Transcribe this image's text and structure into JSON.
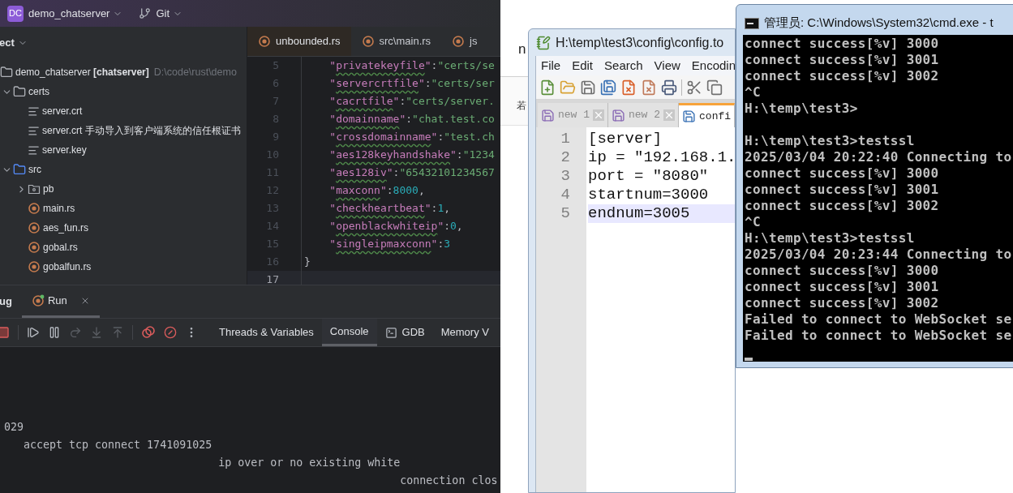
{
  "ide": {
    "project_badge": "DC",
    "project_name": "demo_chatserver",
    "vcs": "Git",
    "project_panel": {
      "title": "ect",
      "tree": [
        {
          "label": "demo_chatserver **[chatserver]**",
          "path": "D:\\code\\rust\\demo",
          "kind": "folder",
          "children": [
            {
              "label": "certs",
              "kind": "folder",
              "expanded": true,
              "children": [
                {
                  "label": "server.crt",
                  "kind": "text"
                },
                {
                  "label": "server.crt 手动导入到客户端系统的信任根证书",
                  "kind": "text"
                },
                {
                  "label": "server.key",
                  "kind": "text"
                }
              ]
            },
            {
              "label": "src",
              "kind": "source-folder",
              "expanded": true,
              "children": [
                {
                  "label": "pb",
                  "kind": "package",
                  "expanded": false
                },
                {
                  "label": "main.rs",
                  "kind": "rust"
                },
                {
                  "label": "aes_fun.rs",
                  "kind": "rust"
                },
                {
                  "label": "gobal.rs",
                  "kind": "rust"
                },
                {
                  "label": "gobalfun.rs",
                  "kind": "rust"
                }
              ]
            }
          ]
        }
      ]
    },
    "editor_tabs": [
      {
        "label": "unbounded.rs",
        "selected": true
      },
      {
        "label": "src\\main.rs",
        "selected": false
      },
      {
        "label": "js",
        "selected": false
      }
    ],
    "code_lines": [
      {
        "number": "5",
        "current": false,
        "tokens": [
          {
            "kind": "quote",
            "text": "    \""
          },
          {
            "kind": "key",
            "text": "privatekeyfile"
          },
          {
            "kind": "quote",
            "text": "\""
          },
          {
            "kind": "punct",
            "text": ":"
          },
          {
            "kind": "string",
            "text": "\"certs/se"
          }
        ]
      },
      {
        "number": "6",
        "current": false,
        "tokens": [
          {
            "kind": "quote",
            "text": "    \""
          },
          {
            "kind": "key",
            "text": "servercrtfile"
          },
          {
            "kind": "quote",
            "text": "\""
          },
          {
            "kind": "punct",
            "text": ":"
          },
          {
            "kind": "string",
            "text": "\"certs/ser"
          }
        ]
      },
      {
        "number": "7",
        "current": false,
        "tokens": [
          {
            "kind": "quote",
            "text": "    \""
          },
          {
            "kind": "key",
            "text": "cacrtfile"
          },
          {
            "kind": "quote",
            "text": "\""
          },
          {
            "kind": "punct",
            "text": ":"
          },
          {
            "kind": "string",
            "text": "\"certs/server."
          }
        ]
      },
      {
        "number": "8",
        "current": false,
        "tokens": [
          {
            "kind": "quote",
            "text": "    \""
          },
          {
            "kind": "key",
            "text": "domainname"
          },
          {
            "kind": "quote",
            "text": "\""
          },
          {
            "kind": "punct",
            "text": ":"
          },
          {
            "kind": "string",
            "text": "\"chat.test.co"
          }
        ]
      },
      {
        "number": "9",
        "current": false,
        "tokens": [
          {
            "kind": "quote",
            "text": "    \""
          },
          {
            "kind": "key",
            "text": "crossdomainname"
          },
          {
            "kind": "quote",
            "text": "\""
          },
          {
            "kind": "punct",
            "text": ":"
          },
          {
            "kind": "string",
            "text": "\"test.ch"
          }
        ]
      },
      {
        "number": "10",
        "current": false,
        "tokens": [
          {
            "kind": "quote",
            "text": "    \""
          },
          {
            "kind": "key",
            "text": "aes128keyhandshake"
          },
          {
            "kind": "quote",
            "text": "\""
          },
          {
            "kind": "punct",
            "text": ":"
          },
          {
            "kind": "string",
            "text": "\"1234"
          }
        ]
      },
      {
        "number": "11",
        "current": false,
        "tokens": [
          {
            "kind": "quote",
            "text": "    \""
          },
          {
            "kind": "key",
            "text": "aes128iv"
          },
          {
            "kind": "quote",
            "text": "\""
          },
          {
            "kind": "punct",
            "text": ":"
          },
          {
            "kind": "string",
            "text": "\"65432101234567"
          }
        ]
      },
      {
        "number": "12",
        "current": false,
        "tokens": [
          {
            "kind": "quote",
            "text": "    \""
          },
          {
            "kind": "key",
            "text": "maxconn"
          },
          {
            "kind": "quote",
            "text": "\""
          },
          {
            "kind": "punct",
            "text": ":"
          },
          {
            "kind": "number",
            "text": "8000"
          },
          {
            "kind": "punct",
            "text": ","
          }
        ]
      },
      {
        "number": "13",
        "current": false,
        "tokens": [
          {
            "kind": "quote",
            "text": "    \""
          },
          {
            "kind": "key",
            "text": "checkheartbeat"
          },
          {
            "kind": "quote",
            "text": "\""
          },
          {
            "kind": "punct",
            "text": ":"
          },
          {
            "kind": "number",
            "text": "1"
          },
          {
            "kind": "punct",
            "text": ","
          }
        ]
      },
      {
        "number": "14",
        "current": false,
        "tokens": [
          {
            "kind": "quote",
            "text": "    \""
          },
          {
            "kind": "key",
            "text": "openblackwhiteip"
          },
          {
            "kind": "quote",
            "text": "\""
          },
          {
            "kind": "punct",
            "text": ":"
          },
          {
            "kind": "number",
            "text": "0"
          },
          {
            "kind": "punct",
            "text": ","
          }
        ]
      },
      {
        "number": "15",
        "current": false,
        "tokens": [
          {
            "kind": "quote",
            "text": "    \""
          },
          {
            "kind": "key",
            "text": "singleipmaxconn"
          },
          {
            "kind": "quote",
            "text": "\""
          },
          {
            "kind": "punct",
            "text": ":"
          },
          {
            "kind": "number",
            "text": "3"
          }
        ]
      },
      {
        "number": "16",
        "current": false,
        "tokens": [
          {
            "kind": "punct",
            "text": "}"
          }
        ]
      },
      {
        "number": "17",
        "current": true
      }
    ],
    "bottom_tabs": [
      {
        "label": "ug",
        "selected": false,
        "closable": false
      },
      {
        "label": "Run",
        "selected": true,
        "closable": true
      }
    ],
    "debug_buttons": [
      {
        "kind": "stop",
        "disabled": false
      },
      {
        "kind": "resume",
        "disabled": false
      },
      {
        "kind": "pause",
        "disabled": false
      },
      {
        "kind": "step-over",
        "disabled": true
      },
      {
        "kind": "step-into",
        "disabled": true
      },
      {
        "kind": "step-out",
        "disabled": true
      },
      {
        "kind": "breakpoints",
        "disabled": false
      },
      {
        "kind": "mute-breakpoints",
        "disabled": false
      },
      {
        "kind": "more",
        "disabled": false
      }
    ],
    "debug_tabs": [
      {
        "label": "Threads & Variables",
        "selected": false,
        "kind": "plain"
      },
      {
        "label": "Console",
        "selected": true,
        "kind": "plain"
      },
      {
        "label": "GDB",
        "selected": false,
        "kind": "terminal"
      },
      {
        "label": "Memory V",
        "selected": false,
        "kind": "plain"
      }
    ],
    "console_lines": [
      "029",
      "   accept tcp connect 1741091025",
      "                                 ip over or no existing white",
      "                                                             connection clos"
    ]
  },
  "background_page": {
    "texts": [
      "n",
      "若"
    ]
  },
  "notepad": {
    "title": "H:\\temp\\test3\\config\\config.to",
    "menu": [
      "File",
      "Edit",
      "Search",
      "View",
      "Encodin"
    ],
    "tabs": [
      {
        "label": "new 1",
        "selected": false
      },
      {
        "label": "new 2",
        "selected": false
      },
      {
        "label": "confi",
        "selected": true
      }
    ],
    "lines": [
      {
        "number": "1",
        "text": "[server]",
        "current": false
      },
      {
        "number": "2",
        "text": "ip = \"192.168.1.",
        "current": false
      },
      {
        "number": "3",
        "text": "port = \"8080\"",
        "current": false
      },
      {
        "number": "4",
        "text": "startnum=3000",
        "current": false
      },
      {
        "number": "5",
        "text": "endnum=3005",
        "current": true
      }
    ]
  },
  "cmd": {
    "title": "管理员: C:\\Windows\\System32\\cmd.exe - t",
    "lines": [
      {
        "kind": "text",
        "text": "connect success[%v] 3000"
      },
      {
        "kind": "text",
        "text": "connect success[%v] 3001"
      },
      {
        "kind": "text",
        "text": "connect success[%v] 3002"
      },
      {
        "kind": "text",
        "text": "^C"
      },
      {
        "kind": "text",
        "text": "H:\\temp\\test3>"
      },
      {
        "kind": "blank"
      },
      {
        "kind": "text",
        "text": "H:\\temp\\test3>testssl"
      },
      {
        "kind": "text",
        "text": "2025/03/04 20:22:40 Connecting to"
      },
      {
        "kind": "text",
        "text": "connect success[%v] 3000"
      },
      {
        "kind": "text",
        "text": "connect success[%v] 3001"
      },
      {
        "kind": "text",
        "text": "connect success[%v] 3002"
      },
      {
        "kind": "text",
        "text": "^C"
      },
      {
        "kind": "text",
        "text": "H:\\temp\\test3>testssl"
      },
      {
        "kind": "text",
        "text": "2025/03/04 20:23:44 Connecting to"
      },
      {
        "kind": "text",
        "text": "connect success[%v] 3000"
      },
      {
        "kind": "text",
        "text": "connect success[%v] 3001"
      },
      {
        "kind": "text",
        "text": "connect success[%v] 3002"
      },
      {
        "kind": "text",
        "text": "Failed to connect to WebSocket se"
      },
      {
        "kind": "text",
        "text": "Failed to connect to WebSocket se"
      }
    ]
  }
}
